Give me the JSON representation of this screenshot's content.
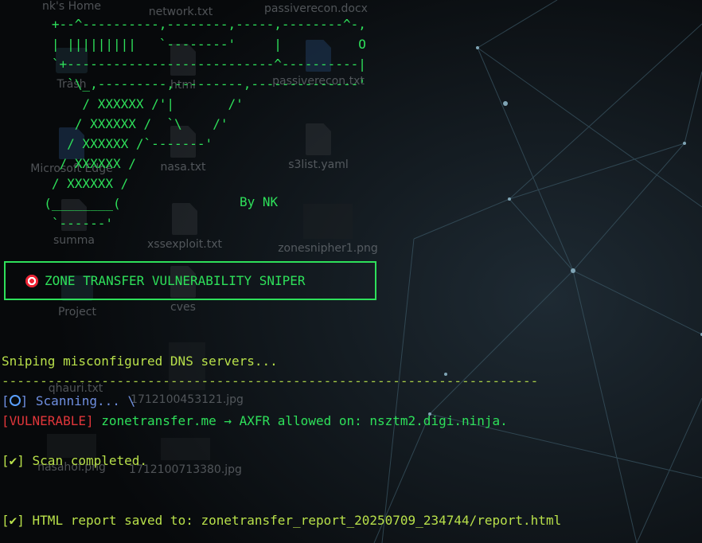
{
  "desktop_icons": [
    {
      "label": "nk's Home"
    },
    {
      "label": "network.txt"
    },
    {
      "label": "passiverecon.docx"
    },
    {
      "label": "Trash"
    },
    {
      "label": "html"
    },
    {
      "label": "passiverecon.txt"
    },
    {
      "label": "Microsoft Edge"
    },
    {
      "label": "nasa.txt"
    },
    {
      "label": "s3list.yaml"
    },
    {
      "label": "summa"
    },
    {
      "label": "xssexploit.txt"
    },
    {
      "label": "zonesnipher1.png"
    },
    {
      "label": "Project"
    },
    {
      "label": "cves"
    },
    {
      "label": "qhauri.txt"
    },
    {
      "label": "1712100453121.jpg"
    },
    {
      "label": "nasahof.png"
    },
    {
      "label": "1712100713380.jpg"
    }
  ],
  "terminal": {
    "ascii_art": "   +--^----------,--------,-----,--------^-,\n   | |||||||||   `--------'     |          O\n   `+---------------------------^----------|\n     `\\_,---------,---------,--------------'\n       / XXXXXX /'|       /'\n      / XXXXXX /  `\\    /'\n     / XXXXXX /`-------'\n    / XXXXXX /\n   / XXXXXX /\n  (________(\n   `------'",
    "byline": "By NK",
    "banner": "ZONE TRANSFER VULNERABILITY SNIPER",
    "sniping": "Sniping misconfigured DNS servers...",
    "divider": "----------------------------------------------------------------------",
    "scan_open": "[",
    "scan_close": "]",
    "scanning": " Scanning... \\",
    "vuln_tag": "[VULNERABLE]",
    "vuln_msg": " zonetransfer.me → AXFR allowed on: nsztm2.digi.ninja.",
    "check_tag": "[✔]",
    "completed": " Scan completed.",
    "report": " HTML report saved to: zonetransfer_report_20250709_234744/report.html"
  },
  "colors": {
    "green": "#2ee05a",
    "yellow_green": "#b8e04a",
    "blue": "#6f8fe0",
    "red": "#e0363a"
  }
}
